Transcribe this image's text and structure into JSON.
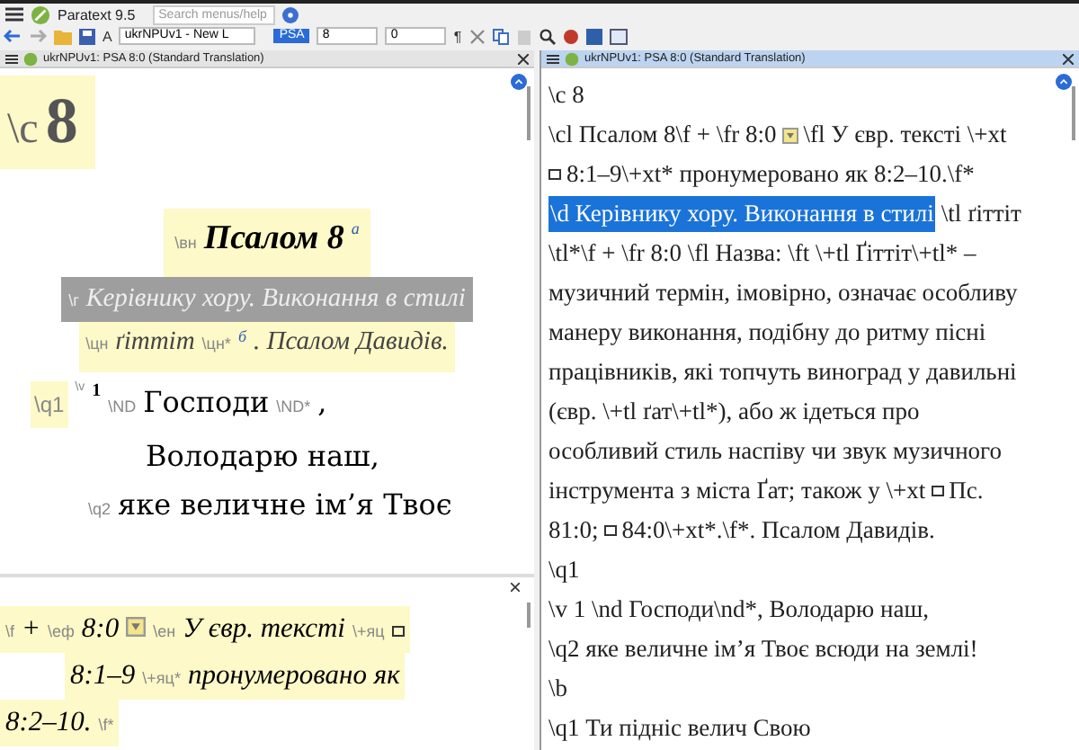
{
  "app": {
    "title": "Paratext 9.5",
    "search": {
      "placeholder": "Search menus/help"
    }
  },
  "toolbar": {
    "font_button": "A",
    "project": "ukrNPUv1 - New L",
    "book": "PSA",
    "chapter": "8",
    "verse": "0",
    "paragraph_button": "¶"
  },
  "left_pane": {
    "title": "ukrNPUv1: PSA 8:0 (Standard Translation)",
    "selected": false,
    "lines": [
      {
        "kind": "chapter",
        "selected": false,
        "segments": [
          {
            "kind": "marker",
            "text": "\\c"
          },
          {
            "kind": "text",
            "text": "8"
          }
        ]
      },
      {
        "kind": "heading",
        "selected": false,
        "segments": [
          {
            "kind": "marker",
            "text": "\\вн"
          },
          {
            "kind": "text",
            "text": "Псалом 8"
          },
          {
            "kind": "caller",
            "text": "а"
          }
        ]
      },
      {
        "kind": "description",
        "selected": true,
        "segments": [
          {
            "kind": "marker",
            "text": "\\г"
          },
          {
            "kind": "text",
            "text": "Керівнику хору. Виконання в стилі"
          }
        ]
      },
      {
        "kind": "description",
        "selected": false,
        "segments": [
          {
            "kind": "marker",
            "text": "\\цн"
          },
          {
            "kind": "text",
            "text": "ґіттіт"
          },
          {
            "kind": "marker",
            "text": "\\цн*"
          },
          {
            "kind": "caller",
            "text": "б"
          },
          {
            "kind": "text",
            "text": ". Псалом Давидів."
          }
        ]
      },
      {
        "kind": "poetry",
        "selected": false,
        "segments": [
          {
            "kind": "para-marker",
            "text": "\\q1"
          },
          {
            "kind": "verse-marker",
            "text": "\\v"
          },
          {
            "kind": "verse",
            "text": "1"
          },
          {
            "kind": "marker",
            "text": "\\ND"
          },
          {
            "kind": "text",
            "text": "Господи"
          },
          {
            "kind": "marker",
            "text": "\\ND*"
          },
          {
            "kind": "text",
            "text": ","
          }
        ]
      },
      {
        "kind": "continuation",
        "selected": false,
        "segments": [
          {
            "kind": "text",
            "text": "Володарю наш,"
          }
        ]
      },
      {
        "kind": "indented",
        "selected": false,
        "segments": [
          {
            "kind": "marker",
            "text": "\\q2"
          },
          {
            "kind": "text",
            "text": "яке величне ім’я Твоє"
          }
        ]
      }
    ],
    "footnote_lines": [
      {
        "kind": "footnote",
        "segments": [
          {
            "kind": "marker",
            "text": "\\f"
          },
          {
            "kind": "text",
            "text": "+"
          },
          {
            "kind": "marker",
            "text": "\\еф"
          },
          {
            "kind": "text",
            "text": "8:0"
          },
          {
            "kind": "note-icon"
          },
          {
            "kind": "marker",
            "text": "\\ен"
          },
          {
            "kind": "text",
            "text": "У євр. тексті"
          },
          {
            "kind": "marker",
            "text": "\\+яц"
          },
          {
            "kind": "link-icon"
          }
        ]
      },
      {
        "kind": "footnote-continuation",
        "segments": [
          {
            "kind": "text",
            "text": "8:1–9"
          },
          {
            "kind": "marker",
            "text": "\\+яц*"
          },
          {
            "kind": "text",
            "text": "пронумеровано як"
          }
        ]
      },
      {
        "kind": "footnote-end",
        "segments": [
          {
            "kind": "text",
            "text": "8:2–10."
          },
          {
            "kind": "marker",
            "text": "\\f*"
          }
        ]
      }
    ]
  },
  "right_pane": {
    "title": "ukrNPUv1: PSA 8:0 (Standard Translation)",
    "selected": true,
    "lines": [
      [
        {
          "kind": "text",
          "text": "\\c 8"
        }
      ],
      [
        {
          "kind": "text",
          "text": "\\cl Псалом 8\\f + \\fr 8:0"
        },
        {
          "kind": "note-icon"
        },
        {
          "kind": "text",
          "text": "\\fl У євр. тексті \\+xt"
        }
      ],
      [
        {
          "kind": "link-icon"
        },
        {
          "kind": "text",
          "text": "8:1–9\\+xt* пронумеровано як 8:2–10.\\f*"
        }
      ],
      [
        {
          "kind": "selection",
          "text": "\\d Керівнику хору. Виконання в стилі"
        },
        {
          "kind": "text",
          "text": "\\tl ґіттіт"
        }
      ],
      [
        {
          "kind": "text",
          "text": "\\tl*\\f + \\fr 8:0 \\fl Назва: \\ft \\+tl Ґіттіт\\+tl* –"
        }
      ],
      [
        {
          "kind": "text",
          "text": "музичний термін, імовірно, означає особливу"
        }
      ],
      [
        {
          "kind": "text",
          "text": "манеру виконання, подібну до ритму пісні"
        }
      ],
      [
        {
          "kind": "text",
          "text": "працівників, які топчуть виноград у давильні"
        }
      ],
      [
        {
          "kind": "text",
          "text": "(євр. \\+tl ґат\\+tl*), або ж ідеться про"
        }
      ],
      [
        {
          "kind": "text",
          "text": "особливий стиль наспіву чи звук музичного"
        }
      ],
      [
        {
          "kind": "text",
          "text": "інструмента з міста Ґат; також у \\+xt"
        },
        {
          "kind": "link-icon"
        },
        {
          "kind": "text",
          "text": "Пс."
        }
      ],
      [
        {
          "kind": "text",
          "text": "81:0;"
        },
        {
          "kind": "link-icon"
        },
        {
          "kind": "text",
          "text": "84:0\\+xt*.\\f*. Псалом Давидів."
        }
      ],
      [
        {
          "kind": "text",
          "text": "\\q1"
        }
      ],
      [
        {
          "kind": "text",
          "text": "\\v 1 \\nd Господи\\nd*, Володарю наш,"
        }
      ],
      [
        {
          "kind": "text",
          "text": "\\q2 яке величне ім’я Твоє всюди на землі!"
        }
      ],
      [
        {
          "kind": "text",
          "text": "\\b"
        }
      ],
      [
        {
          "kind": "text",
          "text": "\\q1 Ти підніс велич Свою"
        }
      ]
    ]
  }
}
